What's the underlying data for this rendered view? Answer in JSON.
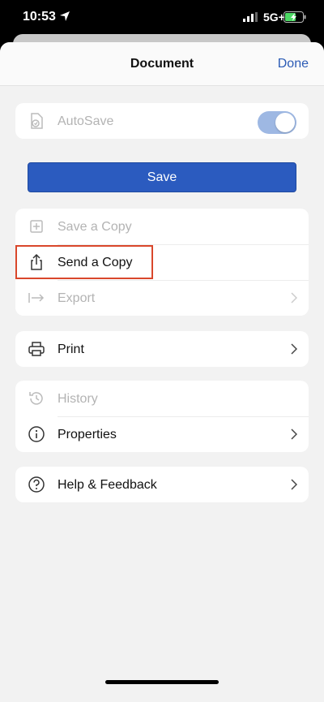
{
  "status_bar": {
    "time": "10:53",
    "network": "5G+"
  },
  "header": {
    "title": "Document",
    "done_label": "Done"
  },
  "autosave": {
    "label": "AutoSave",
    "enabled": true
  },
  "save_button": {
    "label": "Save"
  },
  "group1": [
    {
      "label": "Save a Copy",
      "icon": "save-copy-icon",
      "disabled": true
    },
    {
      "label": "Send a Copy",
      "icon": "share-icon",
      "disabled": false,
      "highlighted": true
    },
    {
      "label": "Export",
      "icon": "export-icon",
      "disabled": true
    }
  ],
  "group2": [
    {
      "label": "Print",
      "icon": "printer-icon"
    }
  ],
  "group3": [
    {
      "label": "History",
      "icon": "history-icon",
      "disabled": true
    },
    {
      "label": "Properties",
      "icon": "info-icon"
    }
  ],
  "group4": [
    {
      "label": "Help & Feedback",
      "icon": "help-icon"
    }
  ],
  "colors": {
    "accent": "#2b5bb5",
    "highlight": "#d9472b",
    "toggle_on": "#9eb8e3"
  }
}
